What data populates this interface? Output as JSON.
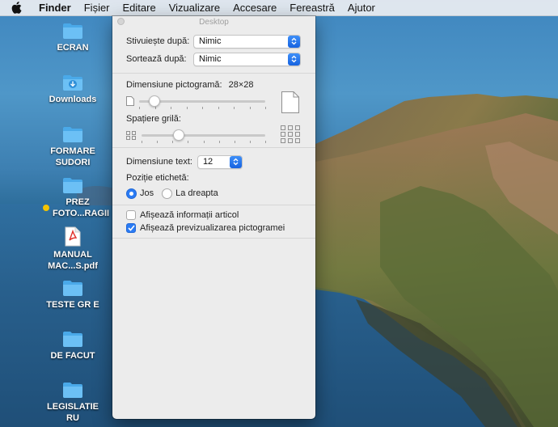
{
  "menubar": {
    "apple_icon": "apple-icon",
    "items": [
      "Finder",
      "Fișier",
      "Editare",
      "Vizualizare",
      "Accesare",
      "Fereastră",
      "Ajutor"
    ]
  },
  "desktop": {
    "icons": [
      {
        "type": "folder",
        "label": "ECRAN"
      },
      {
        "type": "downloads-folder",
        "label": "Downloads"
      },
      {
        "type": "folder",
        "label": "FORMARE SUDORI"
      },
      {
        "type": "folder",
        "label": "PREZ FOTO...RAGII",
        "tag_color": "#f5c400"
      },
      {
        "type": "pdf",
        "label": "MANUAL MAC...S.pdf"
      },
      {
        "type": "folder",
        "label": "TESTE GR E"
      },
      {
        "type": "folder",
        "label": "DE FACUT"
      },
      {
        "type": "folder",
        "label": "LEGISLATIE RU"
      }
    ]
  },
  "panel": {
    "title": "Desktop",
    "stack_by": {
      "label": "Stivuiește după:",
      "value": "Nimic"
    },
    "sort_by": {
      "label": "Sortează după:",
      "value": "Nimic"
    },
    "icon_size": {
      "label": "Dimensiune pictogramă:",
      "value": "28×28",
      "level": 0.12
    },
    "grid_spacing": {
      "label": "Spațiere grilă:",
      "level": 0.3
    },
    "text_size": {
      "label": "Dimensiune text:",
      "value": "12"
    },
    "label_position": {
      "label": "Poziție etichetă:",
      "options": [
        "Jos",
        "La dreapta"
      ],
      "selected": "Jos"
    },
    "show_item_info": {
      "label": "Afișează informații articol",
      "checked": false
    },
    "show_icon_preview": {
      "label": "Afișează previzualizarea pictogramei",
      "checked": true
    }
  },
  "colors": {
    "accent": "#2a7bf4",
    "folder": "#4aa9e9",
    "tag_yellow": "#f5c400"
  }
}
